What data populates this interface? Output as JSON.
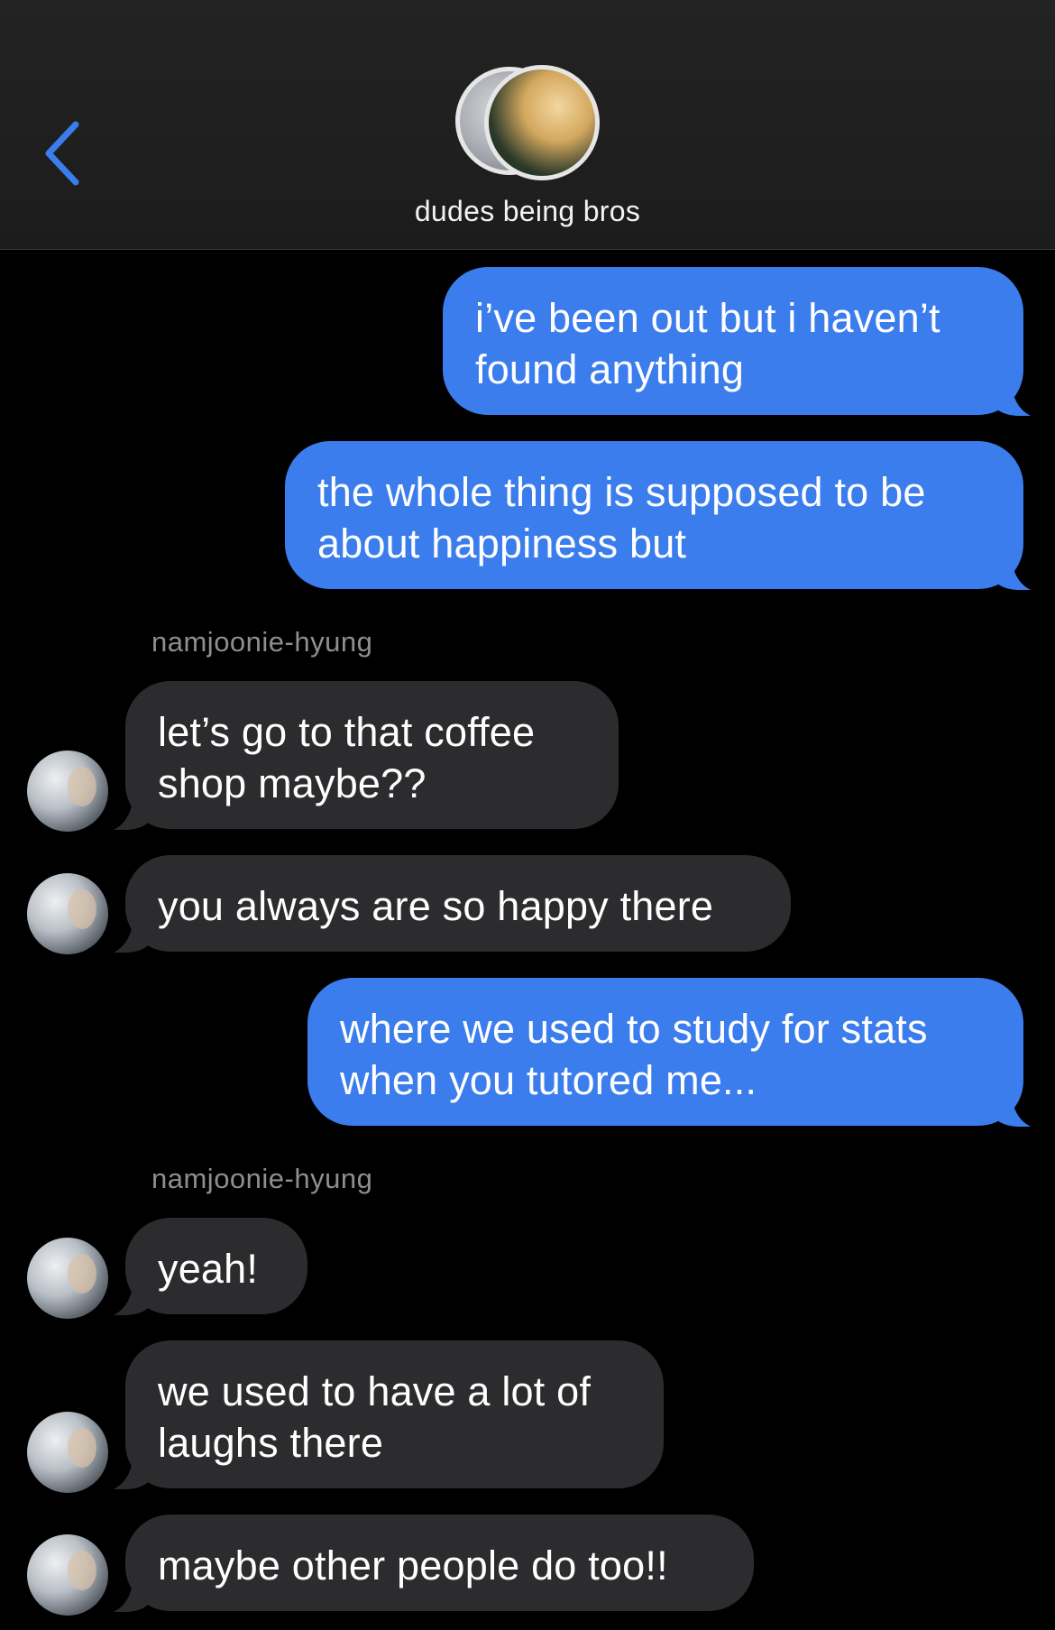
{
  "header": {
    "title": "dudes being bros",
    "back_icon": "chevron-left-icon",
    "accent_color": "#3b7ded"
  },
  "messages": [
    {
      "direction": "outgoing",
      "lines": [
        "i’ve been out but i haven’t",
        "found anything"
      ]
    },
    {
      "direction": "outgoing",
      "lines": [
        "the whole thing is supposed to be",
        "about happiness but"
      ]
    },
    {
      "direction": "sender",
      "name": "namjoonie-hyung"
    },
    {
      "direction": "incoming",
      "lines": [
        "let’s go to that coffee",
        "shop maybe??"
      ]
    },
    {
      "direction": "incoming",
      "lines": [
        "you always are so happy there"
      ]
    },
    {
      "direction": "outgoing",
      "lines": [
        "where we used to study for stats",
        "when you tutored me..."
      ]
    },
    {
      "direction": "sender",
      "name": "namjoonie-hyung"
    },
    {
      "direction": "incoming",
      "lines": [
        "yeah!"
      ]
    },
    {
      "direction": "incoming",
      "lines": [
        "we used to have a lot of",
        "laughs there"
      ]
    },
    {
      "direction": "incoming",
      "lines": [
        "maybe other people do too!!"
      ]
    }
  ],
  "colors": {
    "outgoing_bubble": "#3b7ded",
    "incoming_bubble": "#2c2c2e",
    "background": "#000000",
    "sender_name": "#8e8e93"
  }
}
